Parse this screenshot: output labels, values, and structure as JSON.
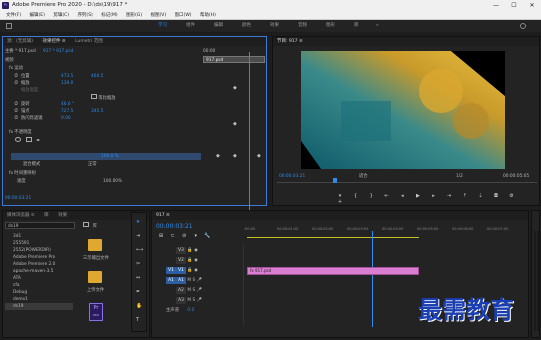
{
  "titlebar": {
    "app_icon": "Pr",
    "title": "Adobe Premiere Pro 2020 - D:\\ds\\19\\917 *",
    "minimize": "—",
    "maximize": "☐",
    "close": "✕"
  },
  "menubar": [
    "文件(F)",
    "编辑(E)",
    "剪辑(C)",
    "序列(S)",
    "标记(M)",
    "图形(G)",
    "视图(V)",
    "窗口(W)",
    "帮助(H)"
  ],
  "workspace": {
    "home_icon": "home-icon",
    "tabs": [
      "学习",
      "组件",
      "编辑",
      "颜色",
      "效果",
      "音频",
      "图形",
      "库"
    ],
    "active": "学习",
    "more": "»"
  },
  "effect_controls": {
    "tabs": [
      "源：(无剪辑)",
      "效果控件 ≡",
      "Lumetri 范围",
      "源：(无剪辑)"
    ],
    "master": "主要 * 917.psd",
    "clip": "917 * 917.psd",
    "timecode_start": "00:00",
    "clip_label": "917.psd",
    "section_video": "视频",
    "motion": "fx 运动",
    "props": [
      {
        "label": "位置",
        "v1": "473.5",
        "v2": "464.5"
      },
      {
        "label": "缩放",
        "v1": "139.0",
        "v2": ""
      },
      {
        "label": "缩放宽度",
        "v1": "",
        "v2": ""
      },
      {
        "label": "",
        "v1": "",
        "v2": ""
      },
      {
        "label": "旋转",
        "v1": "46.6 °",
        "v2": ""
      },
      {
        "label": "锚点",
        "v1": "727.5",
        "v2": "345.5"
      },
      {
        "label": "防闪烁滤镜",
        "v1": "0.00",
        "v2": ""
      }
    ],
    "uniform_scale": "等比缩放",
    "opacity": "fx 不透明度",
    "opacity_value": "100.0 %",
    "blend_label": "混合模式",
    "blend_value": "正常",
    "time_remap": "fx 时间重映射",
    "speed_label": "速度",
    "speed_value": "100.00%",
    "current_time": "00:00:03:21"
  },
  "program": {
    "title": "节目: 917 ≡",
    "timecode": "00:00:03:21",
    "fit": "适合",
    "fraction": "1/2",
    "duration": "00:00:05:05"
  },
  "project": {
    "tabs": [
      "项目:917",
      "媒体浏览器 ≡",
      "库",
      "信息",
      "效果"
    ],
    "drive": "ds19",
    "view_icons": "list-icon",
    "tree": [
      "3d1",
      "255591",
      "255591",
      "2552(POWERDIR)",
      "Adobe Premiere Pro",
      "Adobe Premiere 2.0",
      "apache-maven-3.5",
      "ATA",
      "cfa",
      "Debug",
      "demo1",
      "ds19"
    ],
    "folders": [
      {
        "label": "三示输出文件"
      },
      {
        "label": "上传文件"
      },
      {
        "label": ""
      }
    ],
    "pr_label": "Pr",
    "pr_sub": "PRO"
  },
  "timeline": {
    "title": "917 ≡",
    "timecode": "00:00:03:21",
    "ruler": [
      ":00:00",
      "00:00:01:00",
      "00:00:02:00",
      "00:00:03:00",
      "00:00:04:00",
      "00:00:05:00",
      "00:00:06:00",
      "00:00:07:00"
    ],
    "tracks": [
      "V3",
      "V2",
      "V1",
      "A1",
      "A2",
      "A3",
      "主声道"
    ],
    "master_value": "0.0",
    "clip_label": "fx 917.psd"
  },
  "watermark": "最需教育",
  "colors": {
    "accent": "#2d8ceb",
    "clip": "#d97ed1",
    "bg": "#232323"
  }
}
